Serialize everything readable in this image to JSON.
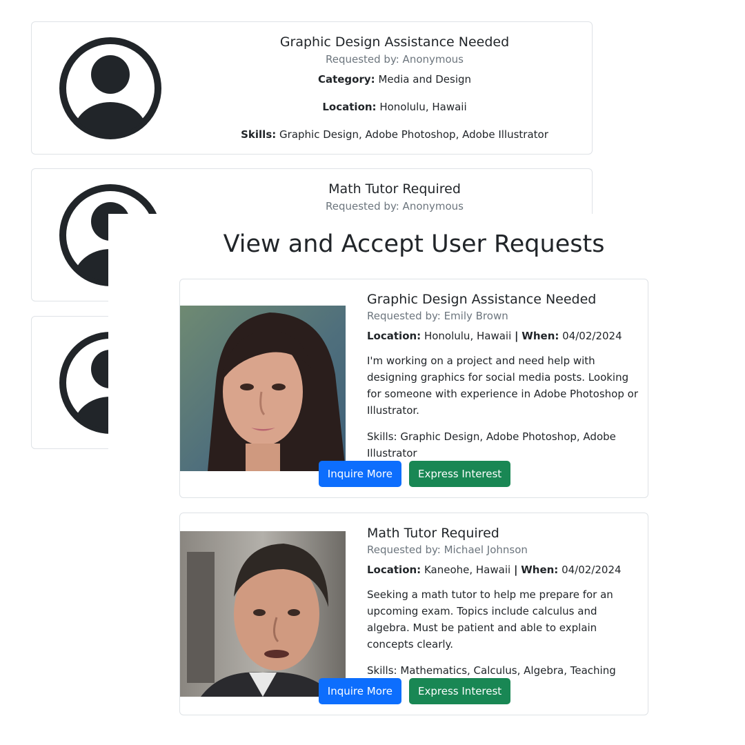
{
  "anonymous_list": [
    {
      "title": "Graphic Design Assistance Needed",
      "requested_by": "Requested by: Anonymous",
      "category_label": "Category:",
      "category": "Media and Design",
      "location_label": "Location:",
      "location": "Honolulu, Hawaii",
      "skills_label": "Skills:",
      "skills": "Graphic Design, Adobe Photoshop, Adobe Illustrator"
    },
    {
      "title": "Math Tutor Required",
      "requested_by": "Requested by: Anonymous"
    },
    {}
  ],
  "page_heading": "View and Accept User Requests",
  "requests": [
    {
      "title": "Graphic Design Assistance Needed",
      "requested_by": "Requested by: Emily Brown",
      "location_label": "Location:",
      "location": "Honolulu, Hawaii",
      "separator": "|",
      "when_label": "When:",
      "when": "04/02/2024",
      "description": "I'm working on a project and need help with designing graphics for social media posts. Looking for someone with experience in Adobe Photoshop or Illustrator.",
      "skills": "Skills: Graphic Design, Adobe Photoshop, Adobe Illustrator",
      "inquire_label": "Inquire More",
      "interest_label": "Express Interest"
    },
    {
      "title": "Math Tutor Required",
      "requested_by": "Requested by: Michael Johnson",
      "location_label": "Location:",
      "location": "Kaneohe, Hawaii",
      "separator": "|",
      "when_label": "When:",
      "when": "04/02/2024",
      "description": "Seeking a math tutor to help me prepare for an upcoming exam. Topics include calculus and algebra. Must be patient and able to explain concepts clearly.",
      "skills": "Skills: Mathematics, Calculus, Algebra, Teaching",
      "inquire_label": "Inquire More",
      "interest_label": "Express Interest"
    }
  ],
  "colors": {
    "primary": "#0d6efd",
    "success": "#198754",
    "muted_text": "#6c757d",
    "border": "#dee2e6"
  }
}
